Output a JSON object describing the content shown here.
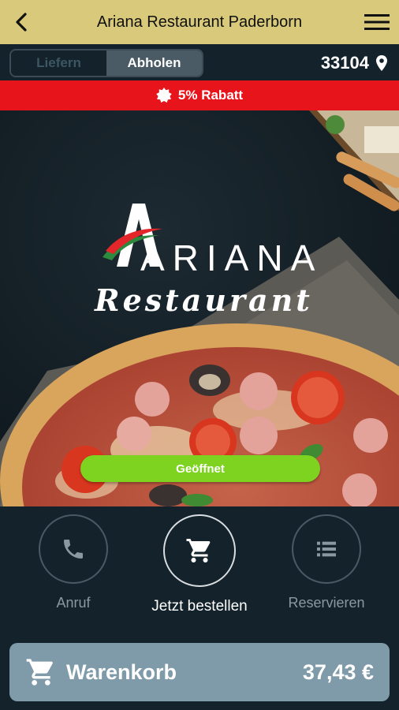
{
  "app": {
    "title": "Ariana Restaurant Paderborn"
  },
  "mode": {
    "options": [
      "Liefern",
      "Abholen"
    ],
    "selected": "Abholen"
  },
  "location": {
    "zip": "33104"
  },
  "promo": {
    "text": "5% Rabatt"
  },
  "hero": {
    "logo_word": "ARIANA",
    "logo_sub": "Restaurant",
    "status": "Geöffnet"
  },
  "actions": [
    {
      "label": "Anruf",
      "icon": "phone-icon"
    },
    {
      "label": "Jetzt bestellen",
      "icon": "cart-icon"
    },
    {
      "label": "Reservieren",
      "icon": "list-icon"
    }
  ],
  "cart": {
    "label": "Warenkorb",
    "amount": "37,43 €"
  },
  "colors": {
    "topbar": "#d9c97a",
    "background": "#13222b",
    "promo": "#e8141b",
    "status": "#7ed321",
    "cart": "#7f9aa8"
  }
}
